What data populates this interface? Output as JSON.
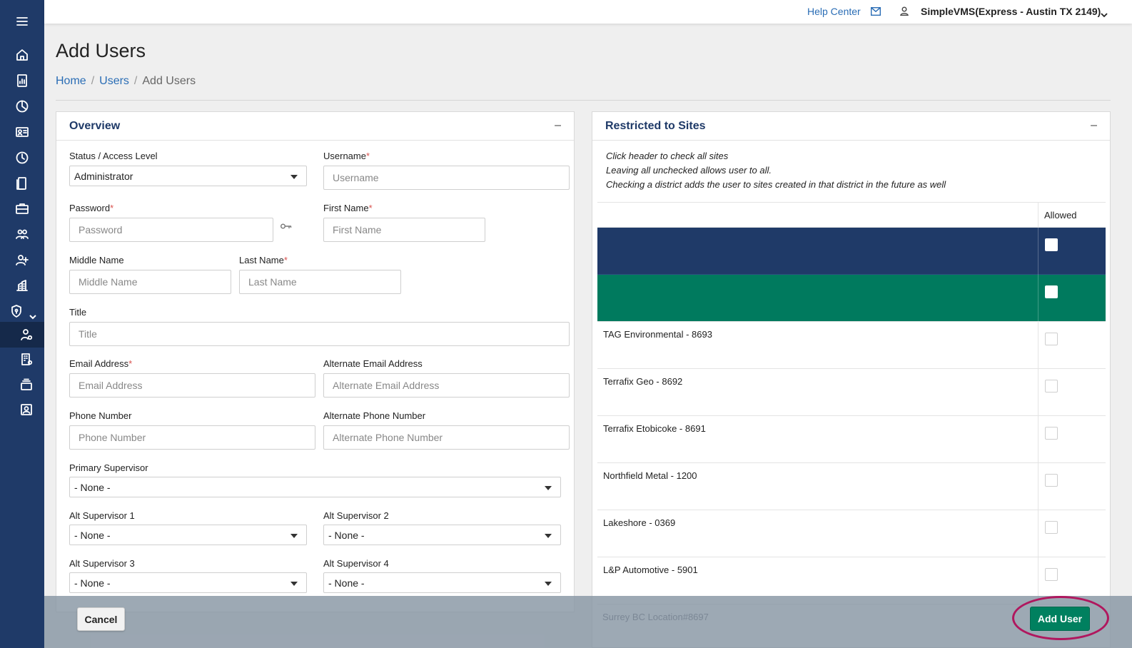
{
  "topbar": {
    "help_label": "Help Center",
    "account_label": "SimpleVMS(Express - Austin TX 2149)"
  },
  "page": {
    "title": "Add Users",
    "breadcrumb": [
      "Home",
      "Users",
      "Add Users"
    ]
  },
  "overview": {
    "title": "Overview",
    "collapse": "–",
    "status_label": "Status / Access Level",
    "status_value": "Administrator",
    "username_label": "Username",
    "username_placeholder": "Username",
    "password_label": "Password",
    "password_placeholder": "Password",
    "firstname_label": "First Name",
    "firstname_placeholder": "First Name",
    "middlename_label": "Middle Name",
    "middlename_placeholder": "Middle Name",
    "lastname_label": "Last Name",
    "lastname_placeholder": "Last Name",
    "title_label": "Title",
    "title_placeholder": "Title",
    "email_label": "Email Address",
    "email_placeholder": "Email Address",
    "alt_email_label": "Alternate Email Address",
    "alt_email_placeholder": "Alternate Email Address",
    "phone_label": "Phone Number",
    "phone_placeholder": "Phone Number",
    "alt_phone_label": "Alternate Phone Number",
    "alt_phone_placeholder": "Alternate Phone Number",
    "primary_sup_label": "Primary Supervisor",
    "primary_sup_value": "- None -",
    "alt_sup1_label": "Alt Supervisor 1",
    "alt_sup1_value": "- None -",
    "alt_sup2_label": "Alt Supervisor 2",
    "alt_sup2_value": "- None -",
    "alt_sup3_label": "Alt Supervisor 3",
    "alt_sup3_value": "- None -",
    "alt_sup4_label": "Alt Supervisor 4",
    "alt_sup4_value": "- None -",
    "required_mark": "*"
  },
  "sites": {
    "title": "Restricted to Sites",
    "collapse": "–",
    "instructions": [
      "Click header to check all sites",
      "Leaving all unchecked allows user to all.",
      "Checking a district adds the user to sites created in that district in the future as well"
    ],
    "allowed_header": "Allowed",
    "rows": [
      "TAG Environmental - 8693",
      "Terrafix Geo - 8692",
      "Terrafix Etobicoke - 8691",
      "Northfield Metal - 1200",
      "Lakeshore - 0369",
      "L&P Automotive - 5901"
    ],
    "partial_row": "Surrey BC Location#8697"
  },
  "footer": {
    "cancel_label": "Cancel",
    "add_label": "Add User"
  },
  "colors": {
    "sidebar": "#1f3a68",
    "accent_green": "#007a5e",
    "highlight": "#b0175e"
  }
}
